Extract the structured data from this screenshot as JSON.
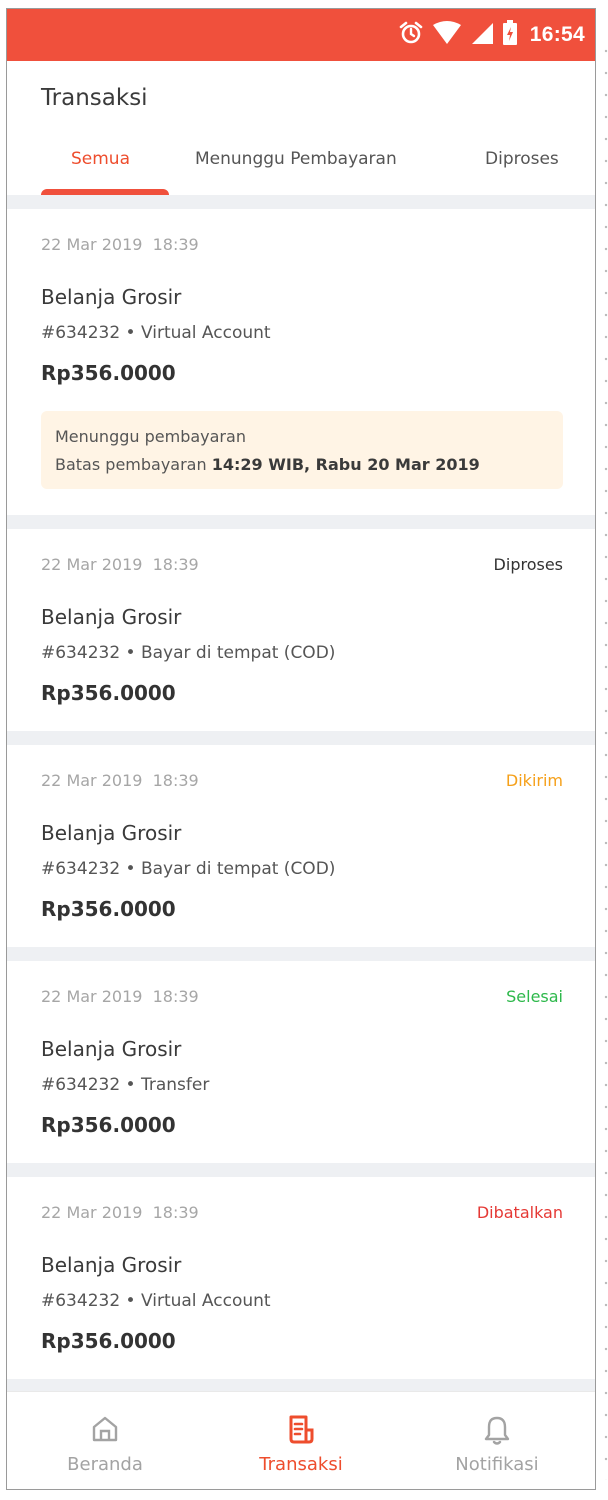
{
  "status_bar": {
    "time": "16:54",
    "icons": [
      "alarm-icon",
      "wifi-icon",
      "signal-icon",
      "battery-icon"
    ]
  },
  "header": {
    "title": "Transaksi"
  },
  "tabs": [
    {
      "label": "Semua",
      "active": true
    },
    {
      "label": "Menunggu Pembayaran",
      "active": false
    },
    {
      "label": "Diproses",
      "active": false
    }
  ],
  "transactions": [
    {
      "date": "22 Mar 2019",
      "time": "18:39",
      "status": "",
      "title": "Belanja Grosir",
      "meta": "#634232 • Virtual Account",
      "price": "Rp356.0000",
      "notice": {
        "line1": "Menunggu pembayaran",
        "line2_prefix": "Batas pembayaran",
        "line2_deadline": "14:29 WIB, Rabu 20 Mar 2019"
      }
    },
    {
      "date": "22 Mar 2019",
      "time": "18:39",
      "status": "Diproses",
      "status_color": "#333333",
      "title": "Belanja Grosir",
      "meta": "#634232 • Bayar di tempat (COD)",
      "price": "Rp356.0000"
    },
    {
      "date": "22 Mar 2019",
      "time": "18:39",
      "status": "Dikirim",
      "status_color": "#f5a01a",
      "title": "Belanja Grosir",
      "meta": "#634232 • Bayar di tempat (COD)",
      "price": "Rp356.0000"
    },
    {
      "date": "22 Mar 2019",
      "time": "18:39",
      "status": "Selesai",
      "status_color": "#2db84b",
      "title": "Belanja Grosir",
      "meta": "#634232 • Transfer",
      "price": "Rp356.0000"
    },
    {
      "date": "22 Mar 2019",
      "time": "18:39",
      "status": "Dibatalkan",
      "status_color": "#e53935",
      "title": "Belanja Grosir",
      "meta": "#634232 • Virtual Account",
      "price": "Rp356.0000"
    }
  ],
  "bottom_nav": [
    {
      "label": "Beranda",
      "icon": "home-icon",
      "active": false
    },
    {
      "label": "Transaksi",
      "icon": "receipt-icon",
      "active": true
    },
    {
      "label": "Notifikasi",
      "icon": "bell-icon",
      "active": false
    }
  ],
  "colors": {
    "accent": "#ee4d2d",
    "status_bar": "#f0503c",
    "background_band": "#eef0f3",
    "notice_bg": "#fff4e5"
  }
}
